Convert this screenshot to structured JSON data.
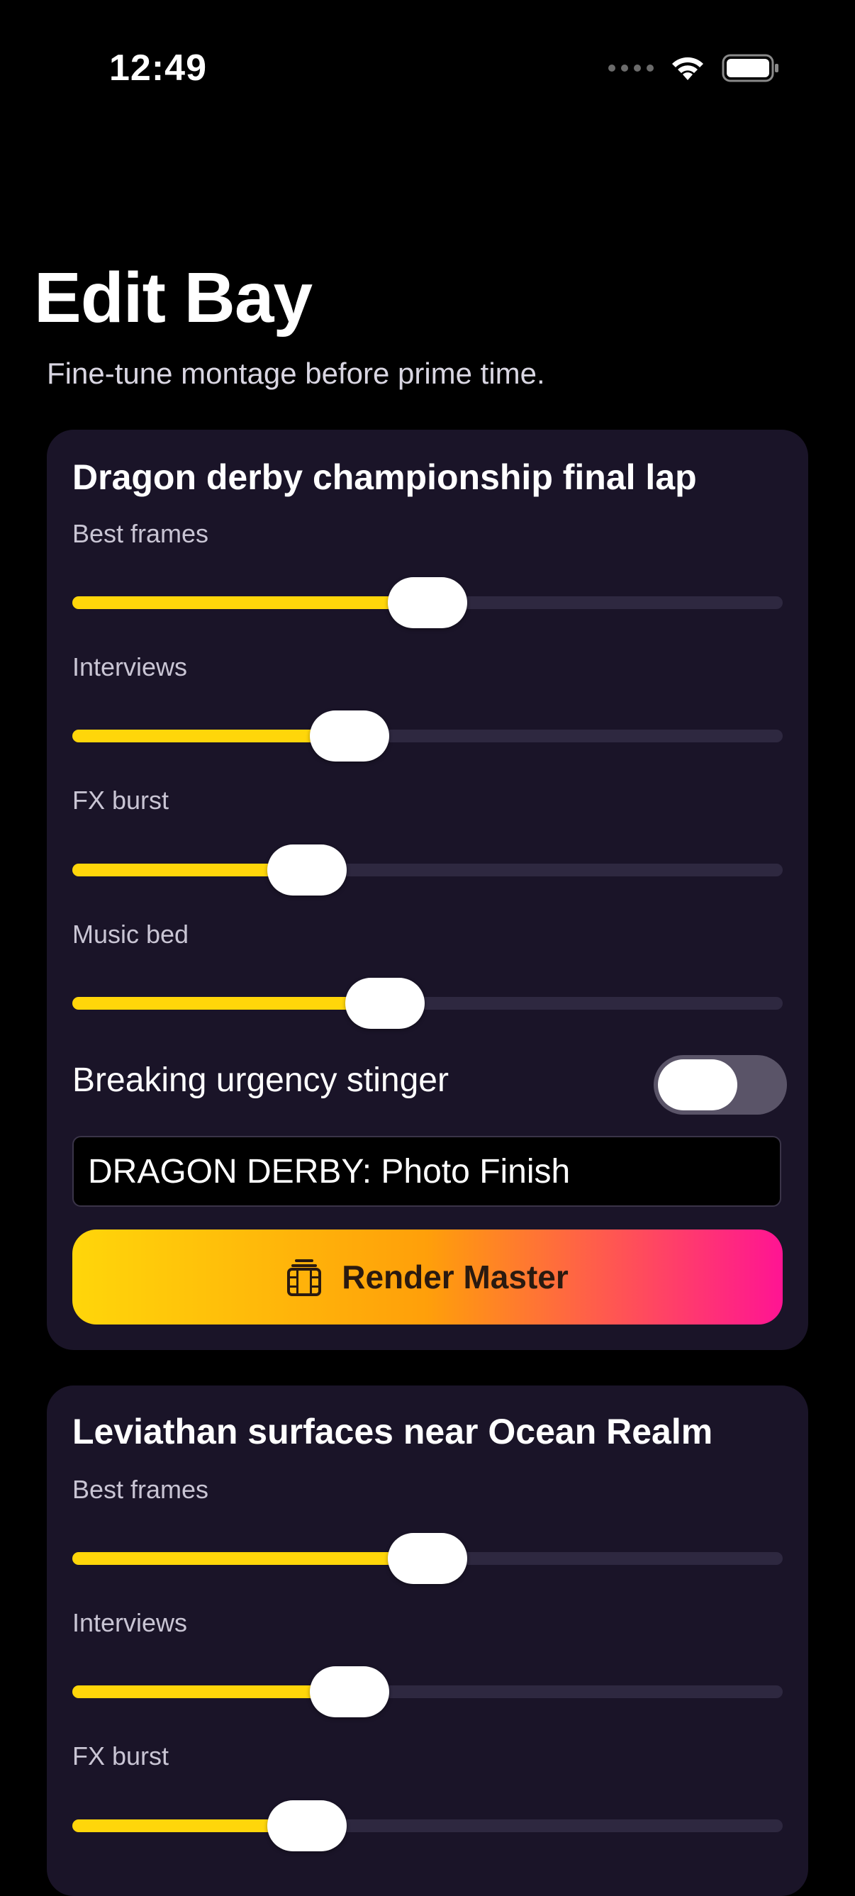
{
  "status": {
    "time": "12:49"
  },
  "header": {
    "title": "Edit Bay",
    "subtitle": "Fine-tune montage before prime time."
  },
  "theme": {
    "accent": "#ffd60a",
    "card_bg": "#1a1428",
    "gradient": [
      "#ffd60a",
      "#ff9f0a",
      "#ff1493"
    ]
  },
  "cards": [
    {
      "title": "Dragon derby championship final lap",
      "sliders": [
        {
          "label": "Best frames",
          "value": 0.5
        },
        {
          "label": "Interviews",
          "value": 0.39
        },
        {
          "label": "FX burst",
          "value": 0.33
        },
        {
          "label": "Music bed",
          "value": 0.44
        }
      ],
      "toggle": {
        "label": "Breaking urgency stinger",
        "on": false
      },
      "headline": {
        "value": "DRAGON DERBY: Photo Finish"
      },
      "button": {
        "label": "Render Master",
        "icon": "film-icon"
      }
    },
    {
      "title": "Leviathan surfaces near Ocean Realm",
      "sliders": [
        {
          "label": "Best frames",
          "value": 0.5
        },
        {
          "label": "Interviews",
          "value": 0.39
        },
        {
          "label": "FX burst",
          "value": 0.33
        }
      ]
    }
  ]
}
